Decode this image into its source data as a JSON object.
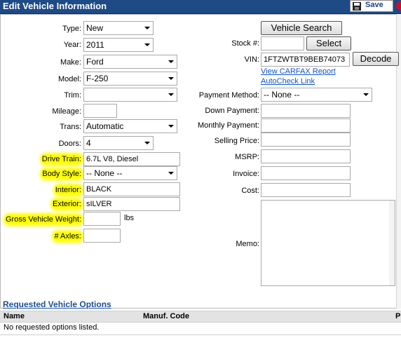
{
  "window": {
    "title": "Edit Vehicle Information",
    "save_label": "Save"
  },
  "left_fields": {
    "type": {
      "label": "Type:",
      "value": "New"
    },
    "year": {
      "label": "Year:",
      "value": "2011"
    },
    "make": {
      "label": "Make:",
      "value": "Ford"
    },
    "model": {
      "label": "Model:",
      "value": "F-250"
    },
    "trim": {
      "label": "Trim:",
      "value": ""
    },
    "mileage": {
      "label": "Mileage:",
      "value": ""
    },
    "trans": {
      "label": "Trans:",
      "value": "Automatic"
    },
    "doors": {
      "label": "Doors:",
      "value": "4"
    },
    "drive_train": {
      "label": "Drive Train:",
      "value": "6.7L V8, Diesel"
    },
    "body_style": {
      "label": "Body Style:",
      "value": "-- None --"
    },
    "interior": {
      "label": "Interior:",
      "value": "BLACK"
    },
    "exterior": {
      "label": "Exterior:",
      "value": "sILVER"
    },
    "gvw": {
      "label": "Gross Vehicle Weight:",
      "value": "",
      "unit": "lbs"
    },
    "axles": {
      "label": "# Axles:",
      "value": ""
    }
  },
  "right_fields": {
    "vehicle_search_label": "Vehicle Search",
    "stock": {
      "label": "Stock #:",
      "value": "",
      "select_label": "Select"
    },
    "vin": {
      "label": "VIN:",
      "value": "1FTZWTBT9BEB74073",
      "decode_label": "Decode"
    },
    "carfax_link": "View CARFAX Report",
    "autocheck_link": "AutoCheck Link",
    "payment_method": {
      "label": "Payment Method:",
      "value": "-- None --"
    },
    "down_payment": {
      "label": "Down Payment:",
      "value": ""
    },
    "monthly_payment": {
      "label": "Monthly Payment:",
      "value": ""
    },
    "selling_price": {
      "label": "Selling Price:",
      "value": ""
    },
    "msrp": {
      "label": "MSRP:",
      "value": ""
    },
    "invoice": {
      "label": "Invoice:",
      "value": ""
    },
    "cost": {
      "label": "Cost:",
      "value": ""
    },
    "memo": {
      "label": "Memo:",
      "value": ""
    }
  },
  "options": {
    "section_title": "Requested Vehicle Options",
    "columns": [
      "Name",
      "Manuf. Code",
      "P"
    ],
    "empty_text": "No requested options listed."
  },
  "colors": {
    "titlebar": "#1e4a86",
    "highlight": "#ffff00",
    "link": "#1155cc"
  }
}
